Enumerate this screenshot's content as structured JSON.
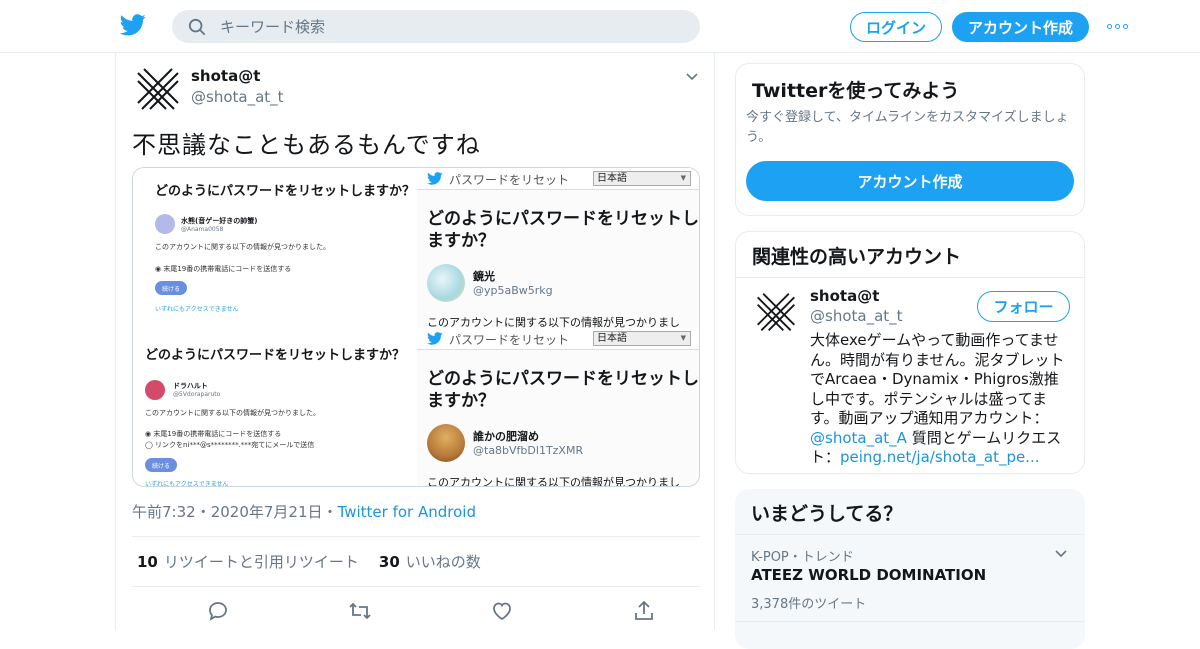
{
  "colors": {
    "accent": "#1da1f2",
    "link": "#1b95e0",
    "muted": "#657786",
    "text": "#14171a",
    "border": "#e6ecf0"
  },
  "header": {
    "search_placeholder": "キーワード検索",
    "login_label": "ログイン",
    "signup_label": "アカウント作成",
    "icons": [
      "twitter-bird-icon",
      "search-icon",
      "more-icon"
    ]
  },
  "tweet": {
    "name": "shota@t",
    "handle": "@shota_at_t",
    "text": "不思議なこともあるもんですね",
    "time": "午前7:32",
    "date": "2020年7月21日",
    "source": "Twitter for Android",
    "retweets": "10",
    "retweets_label": "リツイートと引用リツイート",
    "likes": "30",
    "likes_label": "いいねの数",
    "media": {
      "s1": {
        "title": "どのようにパスワードをリセットしますか？",
        "name": "水熊(音ゲー好きの帥蟹)",
        "handle": "@Anama0058",
        "info": "このアカウントに関する以下の情報が見つかりました。",
        "option1": "◉ 末尾19番の携帯電話にコードを送信する",
        "button": "続ける",
        "link": "いずれにもアクセスできません"
      },
      "s2": {
        "bar_title": "パスワードをリセット",
        "lang": "日本語",
        "title": "どのようにパスワードをリセットしますか？",
        "name": "鏡光",
        "handle": "@yp5aBw5rkg",
        "info": "このアカウントに関する以下の情報が見つかりまし"
      },
      "s3": {
        "title": "どのようにパスワードをリセットしますか？",
        "name": "ドラハルト",
        "handle": "@5Vdoraparuto",
        "info": "このアカウントに関する以下の情報が見つかりました。",
        "option1": "◉ 末尾19番の携帯電話にコードを送信する",
        "option2": "◯ リンクをni***@s********.***宛てにメールで送信",
        "button": "続ける",
        "link": "いずれにもアクセスできません"
      },
      "s4": {
        "bar_title": "パスワードをリセット",
        "lang": "日本語",
        "title": "どのようにパスワードをリセットしますか？",
        "name": "誰かの肥溜め",
        "handle": "@ta8bVfbDl1TzXMR",
        "info": "このアカウントに関する以下の情報が見つかりまし"
      }
    }
  },
  "sidebar": {
    "try": {
      "title": "Twitterを使ってみよう",
      "desc": "今すぐ登録して、タイムラインをカスタマイズしましょう。",
      "button": "アカウント作成"
    },
    "related": {
      "title": "関連性の高いアカウント",
      "name": "shota@t",
      "handle": "@shota_at_t",
      "follow": "フォロー",
      "bio_text": "大体exeゲームやって動画作ってません。時間が有りません。泥タブレットでArcaea・Dynamix・Phigros激推し中です。ポテンシャルは盛ってます。動画アップ通知用アカウント：",
      "bio_link1": "@shota_at_A",
      "bio_mid": " 質問とゲームリクエスト：",
      "bio_link2": "peing.net/ja/shota_at_pe..."
    },
    "trends": {
      "title": "いまどうしてる？",
      "category": "K-POP・トレンド",
      "trend": "ATEEZ WORLD DOMINATION",
      "count": "3,378件のツイート"
    }
  }
}
